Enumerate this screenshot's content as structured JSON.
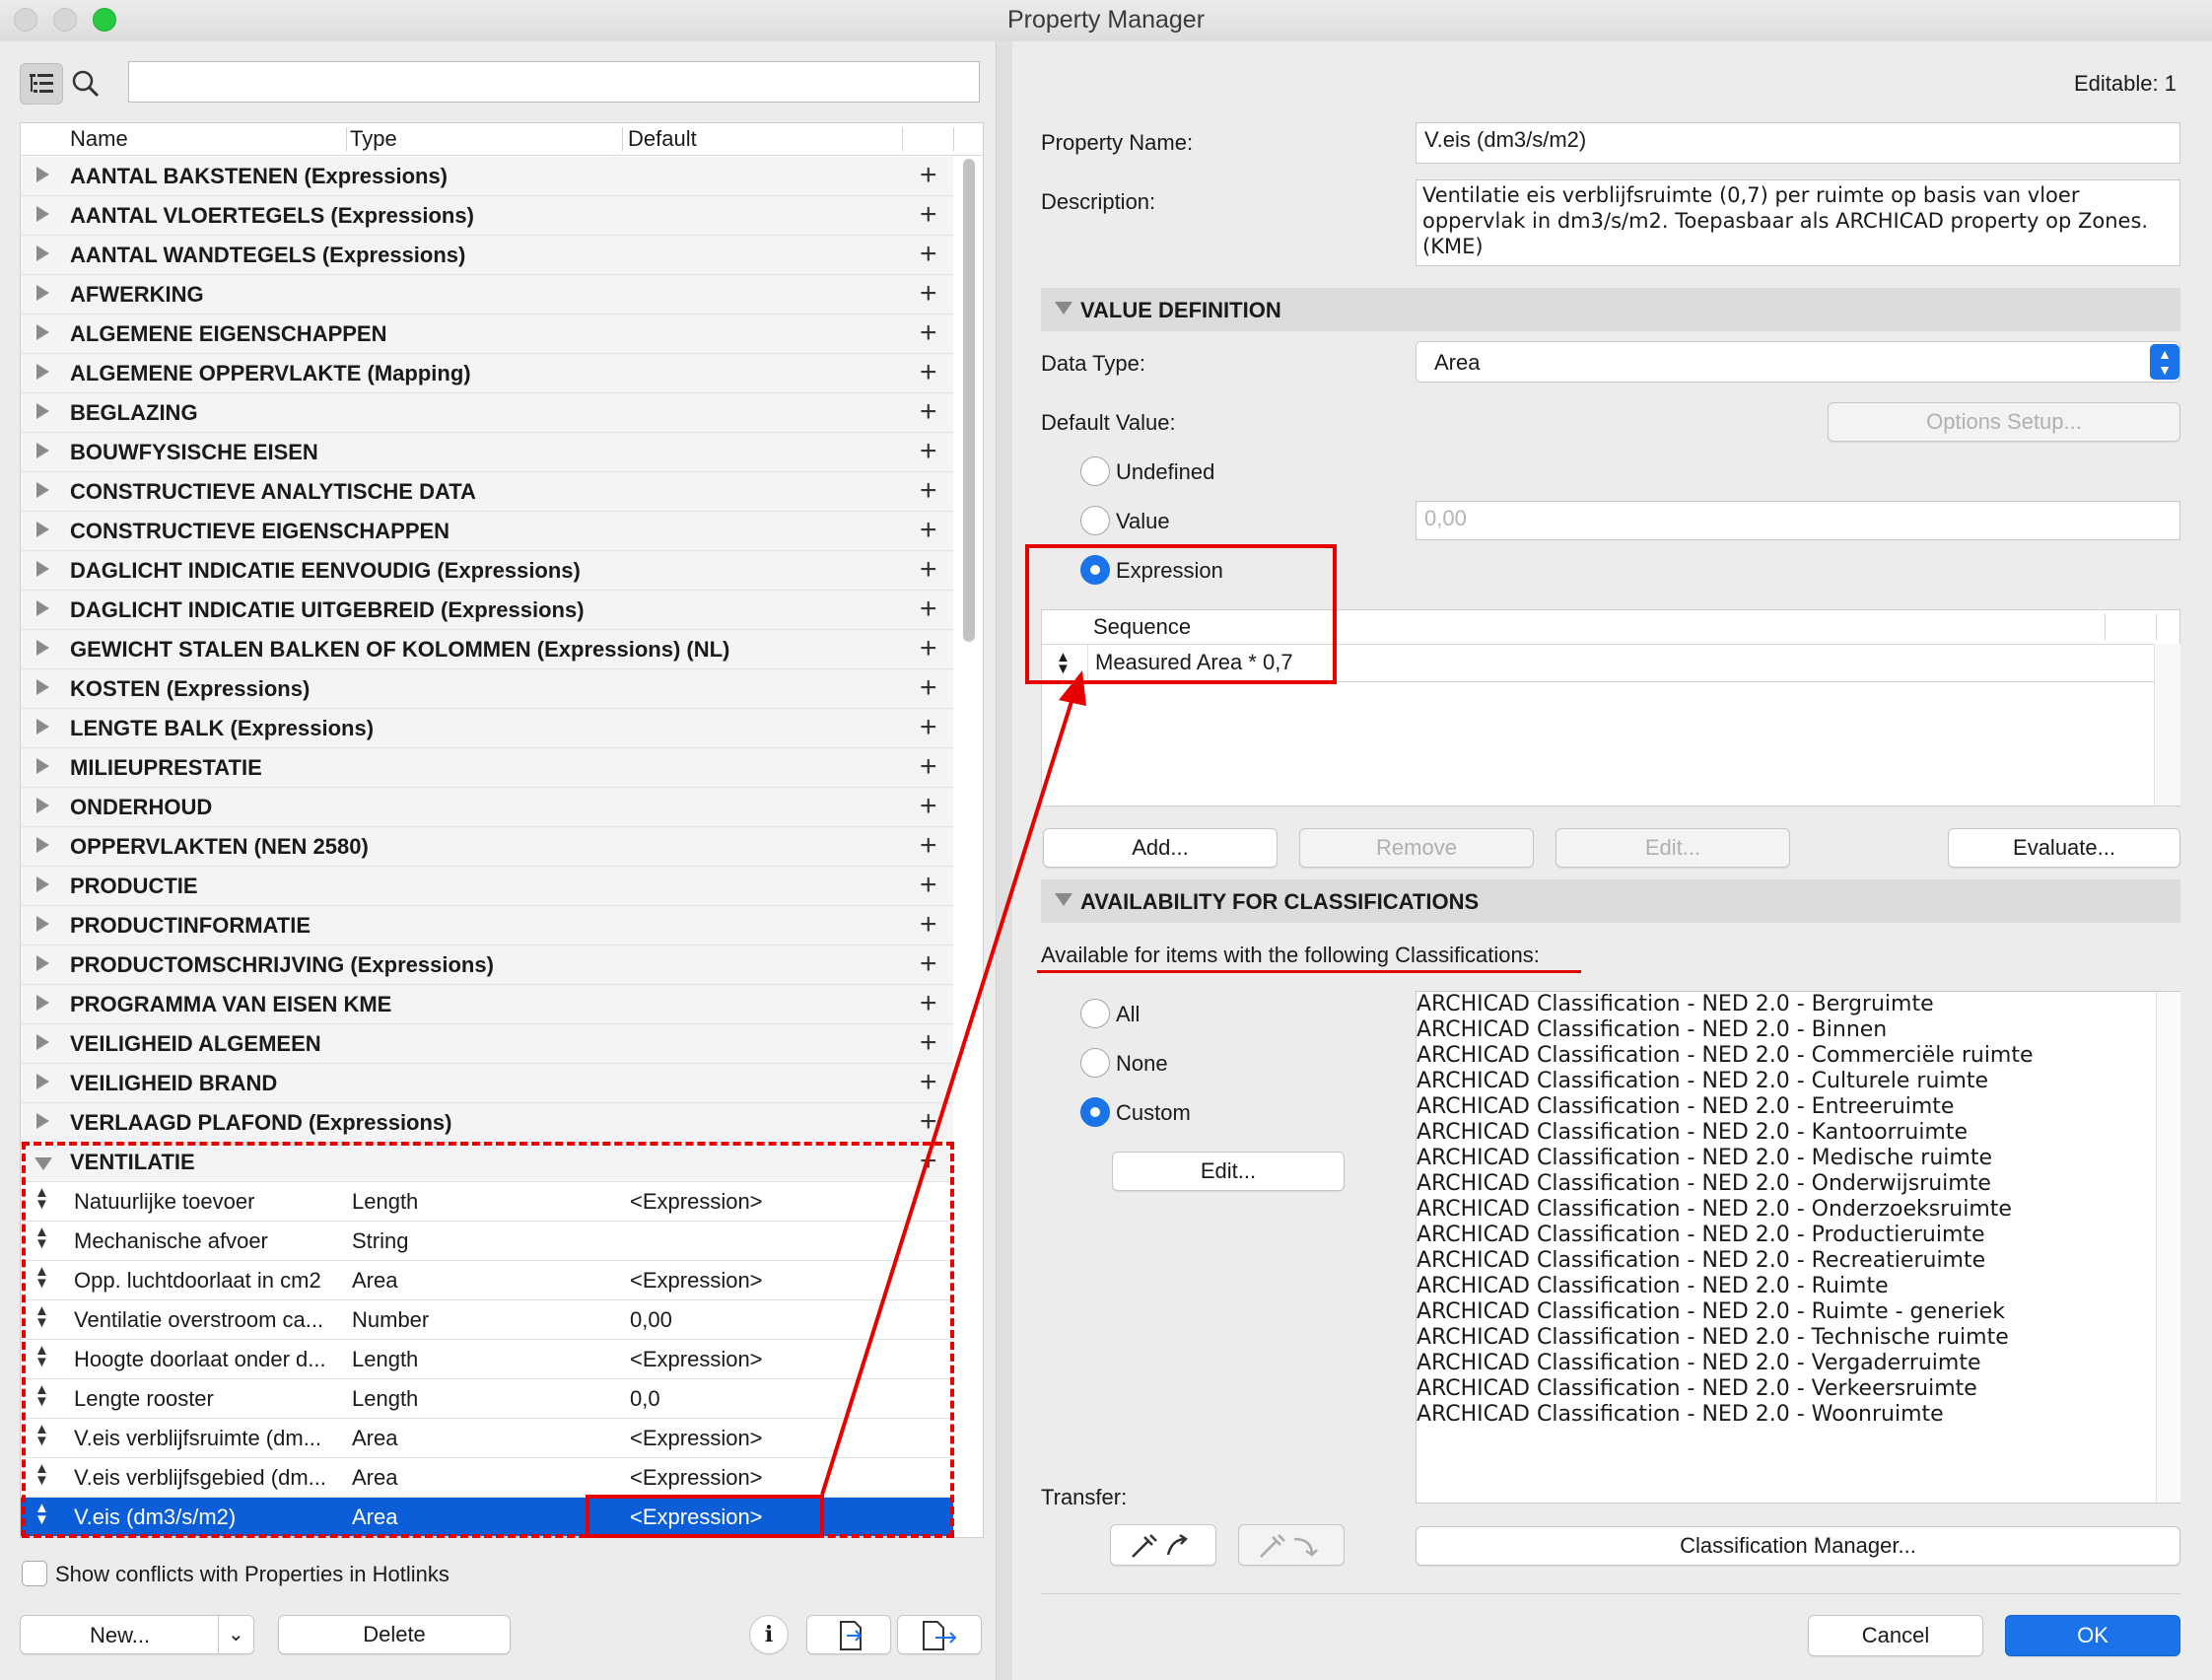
{
  "window": {
    "title": "Property Manager"
  },
  "left": {
    "search": {
      "value": ""
    },
    "columns": {
      "name": "Name",
      "type": "Type",
      "default": "Default"
    },
    "groups": [
      "AANTAL BAKSTENEN (Expressions)",
      "AANTAL VLOERTEGELS (Expressions)",
      "AANTAL WANDTEGELS (Expressions)",
      "AFWERKING",
      "ALGEMENE EIGENSCHAPPEN",
      "ALGEMENE OPPERVLAKTE (Mapping)",
      "BEGLAZING",
      "BOUWFYSISCHE EISEN",
      "CONSTRUCTIEVE ANALYTISCHE DATA",
      "CONSTRUCTIEVE EIGENSCHAPPEN",
      "DAGLICHT INDICATIE EENVOUDIG (Expressions)",
      "DAGLICHT INDICATIE UITGEBREID (Expressions)",
      "GEWICHT STALEN BALKEN OF KOLOMMEN (Expressions) (NL)",
      "KOSTEN (Expressions)",
      "LENGTE BALK (Expressions)",
      "MILIEUPRESTATIE",
      "ONDERHOUD",
      "OPPERVLAKTEN (NEN 2580)",
      "PRODUCTIE",
      "PRODUCTINFORMATIE",
      "PRODUCTOMSCHRIJVING (Expressions)",
      "PROGRAMMA VAN EISEN KME",
      "VEILIGHEID ALGEMEEN",
      "VEILIGHEID BRAND",
      "VERLAAGD PLAFOND (Expressions)"
    ],
    "open_group": "VENTILATIE",
    "items": [
      {
        "name": "Natuurlijke toevoer",
        "type": "Length",
        "default": "<Expression>"
      },
      {
        "name": "Mechanische afvoer",
        "type": "String",
        "default": ""
      },
      {
        "name": "Opp. luchtdoorlaat in cm2",
        "type": "Area",
        "default": "<Expression>"
      },
      {
        "name": "Ventilatie overstroom ca...",
        "type": "Number",
        "default": "0,00"
      },
      {
        "name": "Hoogte doorlaat onder d...",
        "type": "Length",
        "default": "<Expression>"
      },
      {
        "name": "Lengte rooster",
        "type": "Length",
        "default": "0,0"
      },
      {
        "name": "V.eis verblijfsruimte (dm...",
        "type": "Area",
        "default": "<Expression>"
      },
      {
        "name": "V.eis verblijfsgebied (dm...",
        "type": "Area",
        "default": "<Expression>"
      },
      {
        "name": "V.eis (dm3/s/m2)",
        "type": "Area",
        "default": "<Expression>"
      }
    ],
    "show_conflicts": "Show conflicts with Properties in Hotlinks",
    "new_label": "New...",
    "delete_label": "Delete"
  },
  "right": {
    "editable": "Editable: 1",
    "property_name_label": "Property Name:",
    "property_name": "V.eis (dm3/s/m2)",
    "description_label": "Description:",
    "description": "Ventilatie eis verblijfsruimte (0,7) per ruimte op basis van vloer oppervlak in dm3/s/m2. Toepasbaar als ARCHICAD property op Zones. (KME)",
    "value_definition": "VALUE DEFINITION",
    "data_type_label": "Data Type:",
    "data_type": "Area",
    "default_value_label": "Default Value:",
    "options_setup": "Options Setup...",
    "undefined_label": "Undefined",
    "value_label": "Value",
    "value_placeholder": "0,00",
    "expression_label": "Expression",
    "sequence_header": "Sequence",
    "sequence_row": "Measured Area * 0,7",
    "add_btn": "Add...",
    "remove_btn": "Remove",
    "edit_btn": "Edit...",
    "evaluate_btn": "Evaluate...",
    "availability": "AVAILABILITY FOR CLASSIFICATIONS",
    "available_text": "Available for items with the following Classifications:",
    "all_label": "All",
    "none_label": "None",
    "custom_label": "Custom",
    "custom_edit": "Edit...",
    "classifications": [
      "ARCHICAD Classification - NED 2.0 - Bergruimte",
      "ARCHICAD Classification - NED 2.0 - Binnen",
      "ARCHICAD Classification - NED 2.0 - Commerciële ruimte",
      "ARCHICAD Classification - NED 2.0 - Culturele ruimte",
      "ARCHICAD Classification - NED 2.0 - Entreeruimte",
      "ARCHICAD Classification - NED 2.0 - Kantoorruimte",
      "ARCHICAD Classification - NED 2.0 - Medische ruimte",
      "ARCHICAD Classification - NED 2.0 - Onderwijsruimte",
      "ARCHICAD Classification - NED 2.0 - Onderzoeksruimte",
      "ARCHICAD Classification - NED 2.0 - Productieruimte",
      "ARCHICAD Classification - NED 2.0 - Recreatieruimte",
      "ARCHICAD Classification - NED 2.0 - Ruimte",
      "ARCHICAD Classification - NED 2.0 - Ruimte - generiek",
      "ARCHICAD Classification - NED 2.0 - Technische ruimte",
      "ARCHICAD Classification - NED 2.0 - Vergaderruimte",
      "ARCHICAD Classification - NED 2.0 - Verkeersruimte",
      "ARCHICAD Classification - NED 2.0 - Woonruimte"
    ],
    "transfer_label": "Transfer:",
    "classification_manager": "Classification Manager...",
    "cancel": "Cancel",
    "ok": "OK"
  },
  "colors": {
    "accent": "#1a73e8",
    "selection": "#0b5ed7",
    "annotation": "#e60000"
  }
}
